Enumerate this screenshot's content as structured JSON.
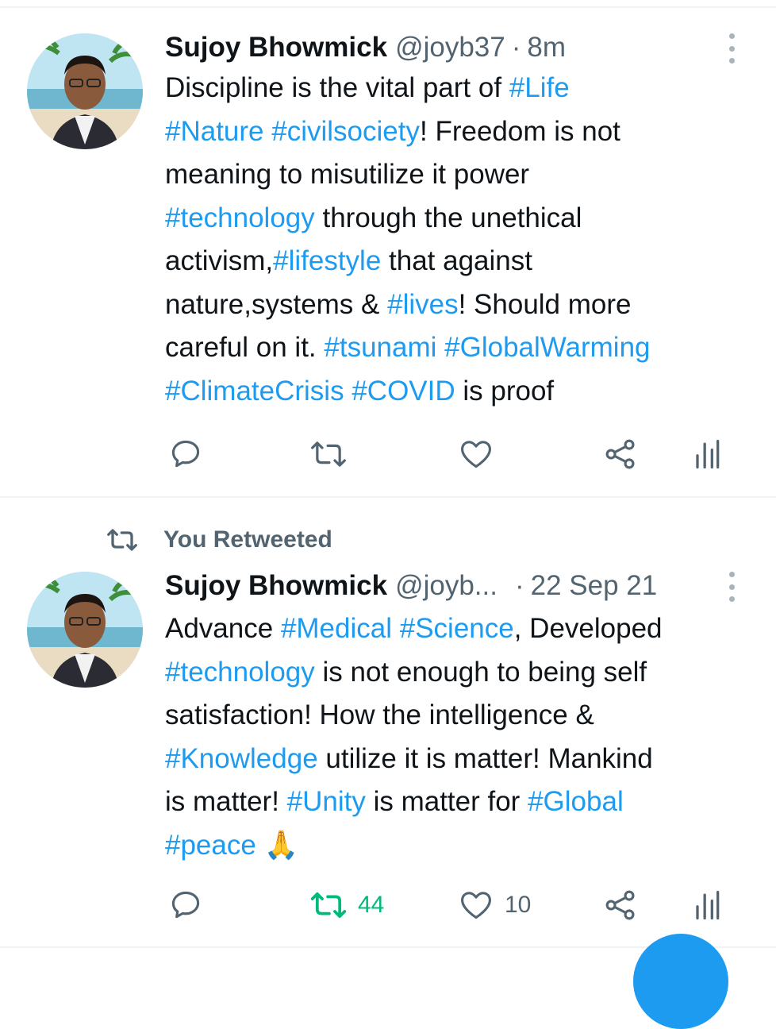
{
  "tweets": [
    {
      "name": "Sujoy Bhowmick",
      "handle": "@joyb37",
      "separator": "·",
      "time": "8m",
      "text_lines": [
        [
          {
            "t": "Discipline is the vital part of "
          },
          {
            "t": "#Life",
            "tag": true
          }
        ],
        [
          {
            "t": "#Nature",
            "tag": true
          },
          {
            "t": " "
          },
          {
            "t": "#civilsociety",
            "tag": true
          },
          {
            "t": "! Freedom is not"
          }
        ],
        [
          {
            "t": "meaning to misutilize it power"
          }
        ],
        [
          {
            "t": "#technology",
            "tag": true
          },
          {
            "t": " through the unethical"
          }
        ],
        [
          {
            "t": "activism,"
          },
          {
            "t": "#lifestyle",
            "tag": true
          },
          {
            "t": " that against"
          }
        ],
        [
          {
            "t": "nature,systems & "
          },
          {
            "t": "#lives",
            "tag": true
          },
          {
            "t": "! Should more"
          }
        ],
        [
          {
            "t": "careful on it. "
          },
          {
            "t": "#tsunami",
            "tag": true
          },
          {
            "t": " "
          },
          {
            "t": "#GlobalWarming",
            "tag": true
          }
        ],
        [
          {
            "t": "#ClimateCrisis",
            "tag": true
          },
          {
            "t": " "
          },
          {
            "t": "#COVID",
            "tag": true
          },
          {
            "t": " is proof"
          }
        ]
      ],
      "actions": {
        "reply_count": "",
        "retweet_count": "",
        "like_count": ""
      }
    },
    {
      "social_context": "You Retweeted",
      "name": "Sujoy Bhowmick",
      "handle": "@joyb...",
      "separator": "·",
      "time": "22 Sep 21",
      "text_lines": [
        [
          {
            "t": "Advance "
          },
          {
            "t": "#Medical",
            "tag": true
          },
          {
            "t": " "
          },
          {
            "t": "#Science",
            "tag": true
          },
          {
            "t": ", Developed"
          }
        ],
        [
          {
            "t": "#technology",
            "tag": true
          },
          {
            "t": " is not enough to being self"
          }
        ],
        [
          {
            "t": "satisfaction! How the intelligence &"
          }
        ],
        [
          {
            "t": "#Knowledge",
            "tag": true
          },
          {
            "t": " utilize it is matter! Mankind"
          }
        ],
        [
          {
            "t": "is matter! "
          },
          {
            "t": "#Unity",
            "tag": true
          },
          {
            "t": " is matter for "
          },
          {
            "t": "#Global",
            "tag": true
          }
        ],
        [
          {
            "t": "#peace",
            "tag": true
          },
          {
            "t": " 🙏"
          }
        ]
      ],
      "actions": {
        "reply_count": "",
        "retweet_count": "44",
        "like_count": "10"
      }
    }
  ],
  "colors": {
    "link": "#1d9bf0",
    "muted": "#536471",
    "retweet_active": "#00ba7c",
    "text": "#0f1419"
  },
  "icons": [
    "reply-icon",
    "retweet-icon",
    "like-icon",
    "share-icon",
    "analytics-icon",
    "more-options-icon"
  ]
}
